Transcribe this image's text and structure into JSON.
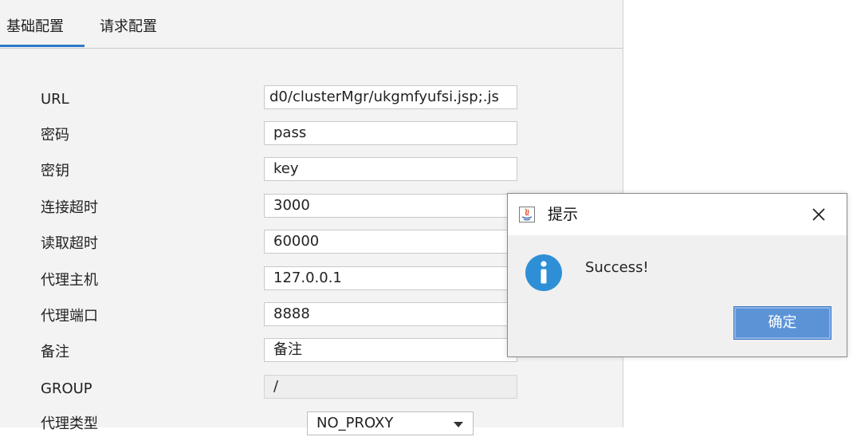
{
  "tabs": [
    {
      "label": "基础配置",
      "active": true
    },
    {
      "label": "请求配置",
      "active": false
    }
  ],
  "form": {
    "url_label": "URL",
    "url_value": "d0/clusterMgr/ukgmfyufsi.jsp;.js",
    "password_label": "密码",
    "password_value": "pass",
    "key_label": "密钥",
    "key_value": "key",
    "connect_timeout_label": "连接超时",
    "connect_timeout_value": "3000",
    "read_timeout_label": "读取超时",
    "read_timeout_value": "60000",
    "proxy_host_label": "代理主机",
    "proxy_host_value": "127.0.0.1",
    "proxy_port_label": "代理端口",
    "proxy_port_value": "8888",
    "remark_label": "备注",
    "remark_value": "备注",
    "group_label": "GROUP",
    "group_value": "/",
    "proxy_type_label": "代理类型",
    "proxy_type_value": "NO_PROXY"
  },
  "dialog": {
    "title": "提示",
    "message": "Success!",
    "ok_label": "确定",
    "icons": {
      "title": "java-icon",
      "close": "close-icon",
      "info": "info-icon"
    }
  },
  "colors": {
    "accent": "#2f79c7",
    "info_blue": "#2e8fd6",
    "ok_button": "#5b93d6"
  }
}
